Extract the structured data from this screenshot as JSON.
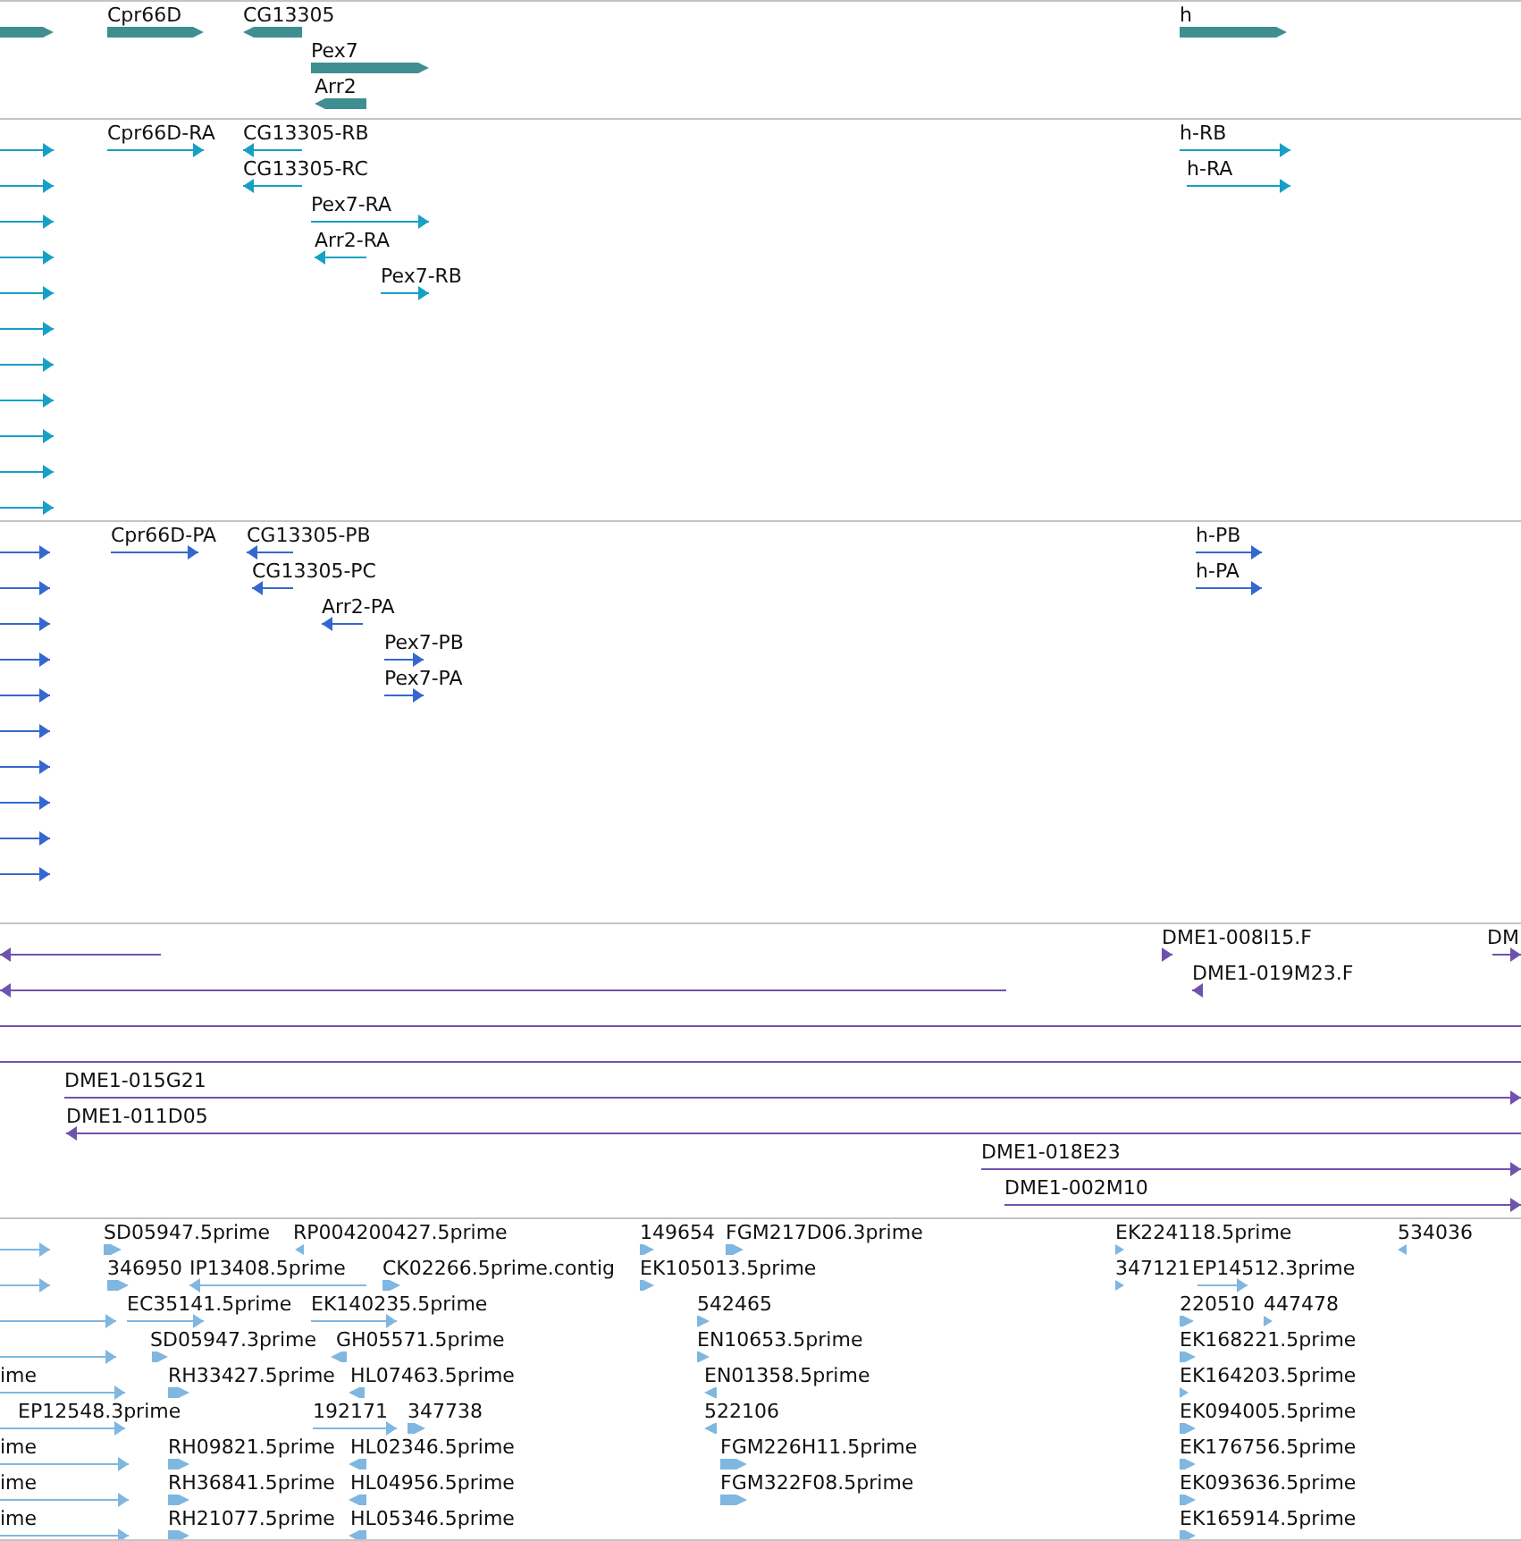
{
  "tracks": [
    {
      "kind": "gene",
      "features": [
        {
          "reverse": false
        },
        {
          "label": "Cpr66D",
          "reverse": false
        },
        {
          "label": "CG13305",
          "reverse": true
        },
        {
          "label": "Pex7",
          "reverse": false
        },
        {
          "label": "Arr2",
          "reverse": true
        },
        {
          "label": "h",
          "reverse": false
        }
      ]
    },
    {
      "kind": "transcript",
      "features": [
        {
          "reverse": false
        },
        {
          "reverse": false
        },
        {
          "reverse": false
        },
        {
          "reverse": false
        },
        {
          "reverse": false
        },
        {
          "reverse": false
        },
        {
          "reverse": false
        },
        {
          "reverse": false
        },
        {
          "reverse": false
        },
        {
          "reverse": false
        },
        {
          "reverse": false
        },
        {
          "label": "Cpr66D-RA",
          "reverse": false
        },
        {
          "label": "CG13305-RB",
          "reverse": true
        },
        {
          "label": "CG13305-RC",
          "reverse": true
        },
        {
          "label": "Pex7-RA",
          "reverse": false
        },
        {
          "label": "Arr2-RA",
          "reverse": true
        },
        {
          "label": "Pex7-RB",
          "reverse": false
        },
        {
          "label": "h-RB",
          "reverse": false
        },
        {
          "label": "h-RA",
          "reverse": false
        }
      ]
    },
    {
      "kind": "protein",
      "features": [
        {
          "reverse": false
        },
        {
          "reverse": false
        },
        {
          "reverse": false
        },
        {
          "reverse": false
        },
        {
          "reverse": false
        },
        {
          "reverse": false
        },
        {
          "reverse": false
        },
        {
          "reverse": false
        },
        {
          "reverse": false
        },
        {
          "reverse": false
        },
        {
          "label": "Cpr66D-PA",
          "reverse": false
        },
        {
          "label": "CG13305-PB",
          "reverse": true
        },
        {
          "label": "CG13305-PC",
          "reverse": true
        },
        {
          "label": "Arr2-PA",
          "reverse": true
        },
        {
          "label": "Pex7-PB",
          "reverse": false
        },
        {
          "label": "Pex7-PA",
          "reverse": false
        },
        {
          "label": "h-PB",
          "reverse": false
        },
        {
          "label": "h-PA",
          "reverse": false
        }
      ]
    },
    {
      "kind": "clone",
      "features": [
        {
          "kind": "arrow",
          "reverse": true
        },
        {
          "kind": "arrow",
          "reverse": true
        },
        {
          "kind": "span"
        },
        {
          "kind": "span"
        },
        {
          "kind": "arrow",
          "label": "DME1-008I15.F",
          "reverse": false
        },
        {
          "kind": "arrow",
          "label": "DME1-019M23.F",
          "reverse": true
        },
        {
          "kind": "arrow",
          "label": "DM",
          "reverse": false
        },
        {
          "kind": "arrow",
          "label": "DME1-015G21",
          "reverse": false
        },
        {
          "kind": "arrow",
          "label": "DME1-011D05",
          "reverse": true
        },
        {
          "kind": "arrow",
          "label": "DME1-018E23",
          "reverse": false
        },
        {
          "kind": "arrow",
          "label": "DME1-002M10",
          "reverse": false
        }
      ]
    },
    {
      "kind": "est",
      "features": [
        {
          "reverse": false
        },
        {
          "label": "SD05947.5prime",
          "reverse": false
        },
        {
          "label": "RP004200427.5prime",
          "reverse": true
        },
        {
          "label": "149654",
          "reverse": false
        },
        {
          "label": "FGM217D06.3prime",
          "reverse": false
        },
        {
          "label": "EK224118.5prime",
          "reverse": false
        },
        {
          "label": "534036",
          "reverse": true
        },
        {
          "reverse": false
        },
        {
          "label": "346950",
          "reverse": false
        },
        {
          "label": "IP13408.5prime",
          "reverse": true
        },
        {
          "label": "CK02266.5prime.contig",
          "reverse": false
        },
        {
          "label": "EK105013.5prime",
          "reverse": false
        },
        {
          "label": "347121",
          "reverse": false
        },
        {
          "label": "EP14512.3prime",
          "reverse": false
        },
        {
          "reverse": false
        },
        {
          "label": "EC35141.5prime",
          "reverse": false
        },
        {
          "label": "EK140235.5prime",
          "reverse": false
        },
        {
          "label": "542465",
          "reverse": false
        },
        {
          "label": "220510",
          "reverse": false
        },
        {
          "label": "447478",
          "reverse": false
        },
        {
          "reverse": false
        },
        {
          "label": "SD05947.3prime",
          "reverse": false
        },
        {
          "label": "GH05571.5prime",
          "reverse": true
        },
        {
          "label": "EN10653.5prime",
          "reverse": false
        },
        {
          "label": "EK168221.5prime",
          "reverse": false
        },
        {
          "label": "ime",
          "reverse": false
        },
        {
          "label": "RH33427.5prime",
          "reverse": false
        },
        {
          "label": "HL07463.5prime",
          "reverse": true
        },
        {
          "label": "EN01358.5prime",
          "reverse": true
        },
        {
          "label": "EK164203.5prime",
          "reverse": false
        },
        {
          "label": "EP12548.3prime",
          "reverse": false
        },
        {
          "label": "192171",
          "reverse": false
        },
        {
          "label": "347738",
          "reverse": false
        },
        {
          "label": "522106",
          "reverse": true
        },
        {
          "label": "EK094005.5prime",
          "reverse": false
        },
        {
          "label": "ime",
          "reverse": false
        },
        {
          "label": "RH09821.5prime",
          "reverse": false
        },
        {
          "label": "HL02346.5prime",
          "reverse": true
        },
        {
          "label": "FGM226H11.5prime",
          "reverse": false
        },
        {
          "label": "EK176756.5prime",
          "reverse": false
        },
        {
          "label": "ime",
          "reverse": false
        },
        {
          "label": "RH36841.5prime",
          "reverse": false
        },
        {
          "label": "HL04956.5prime",
          "reverse": true
        },
        {
          "label": "FGM322F08.5prime",
          "reverse": false
        },
        {
          "label": "EK093636.5prime",
          "reverse": false
        },
        {
          "label": "ime",
          "reverse": false
        },
        {
          "label": "RH21077.5prime",
          "reverse": false
        },
        {
          "label": "HL05346.5prime",
          "reverse": true
        },
        {
          "label": "EK165914.5prime",
          "reverse": false
        }
      ]
    }
  ]
}
